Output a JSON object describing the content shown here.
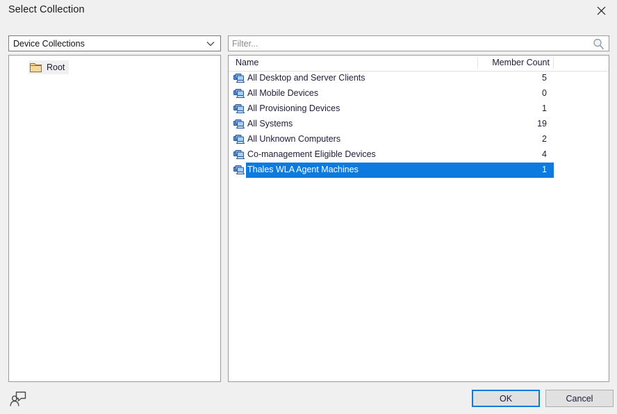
{
  "dialog": {
    "title": "Select Collection",
    "close_icon": "close-icon"
  },
  "left_panel": {
    "combo": {
      "selected": "Device Collections",
      "arrow_icon": "chevron-down-icon"
    },
    "tree": {
      "root_label": "Root",
      "root_icon": "folder-icon"
    }
  },
  "right_panel": {
    "filter": {
      "value": "",
      "placeholder": "Filter...",
      "search_icon": "search-icon"
    },
    "columns": {
      "name": "Name",
      "member_count": "Member Count"
    },
    "rows": [
      {
        "name": "All Desktop and Server Clients",
        "count": "5",
        "icon": "collection-icon",
        "selected": false
      },
      {
        "name": "All Mobile Devices",
        "count": "0",
        "icon": "collection-icon",
        "selected": false
      },
      {
        "name": "All Provisioning Devices",
        "count": "1",
        "icon": "collection-icon",
        "selected": false
      },
      {
        "name": "All Systems",
        "count": "19",
        "icon": "collection-icon",
        "selected": false
      },
      {
        "name": "All Unknown Computers",
        "count": "2",
        "icon": "collection-icon",
        "selected": false
      },
      {
        "name": "Co-management Eligible Devices",
        "count": "4",
        "icon": "collection-icon",
        "selected": false
      },
      {
        "name": "Thales WLA Agent Machines",
        "count": "1",
        "icon": "collection-icon",
        "selected": true
      }
    ]
  },
  "footer": {
    "feedback_icon": "person-speech-bubble-icon",
    "ok_label": "OK",
    "cancel_label": "Cancel"
  },
  "colors": {
    "selection_blue": "#0d7ae0",
    "dialog_background": "#f0f0f0",
    "panel_background": "#ffffff",
    "border": "#9a9a9a"
  }
}
